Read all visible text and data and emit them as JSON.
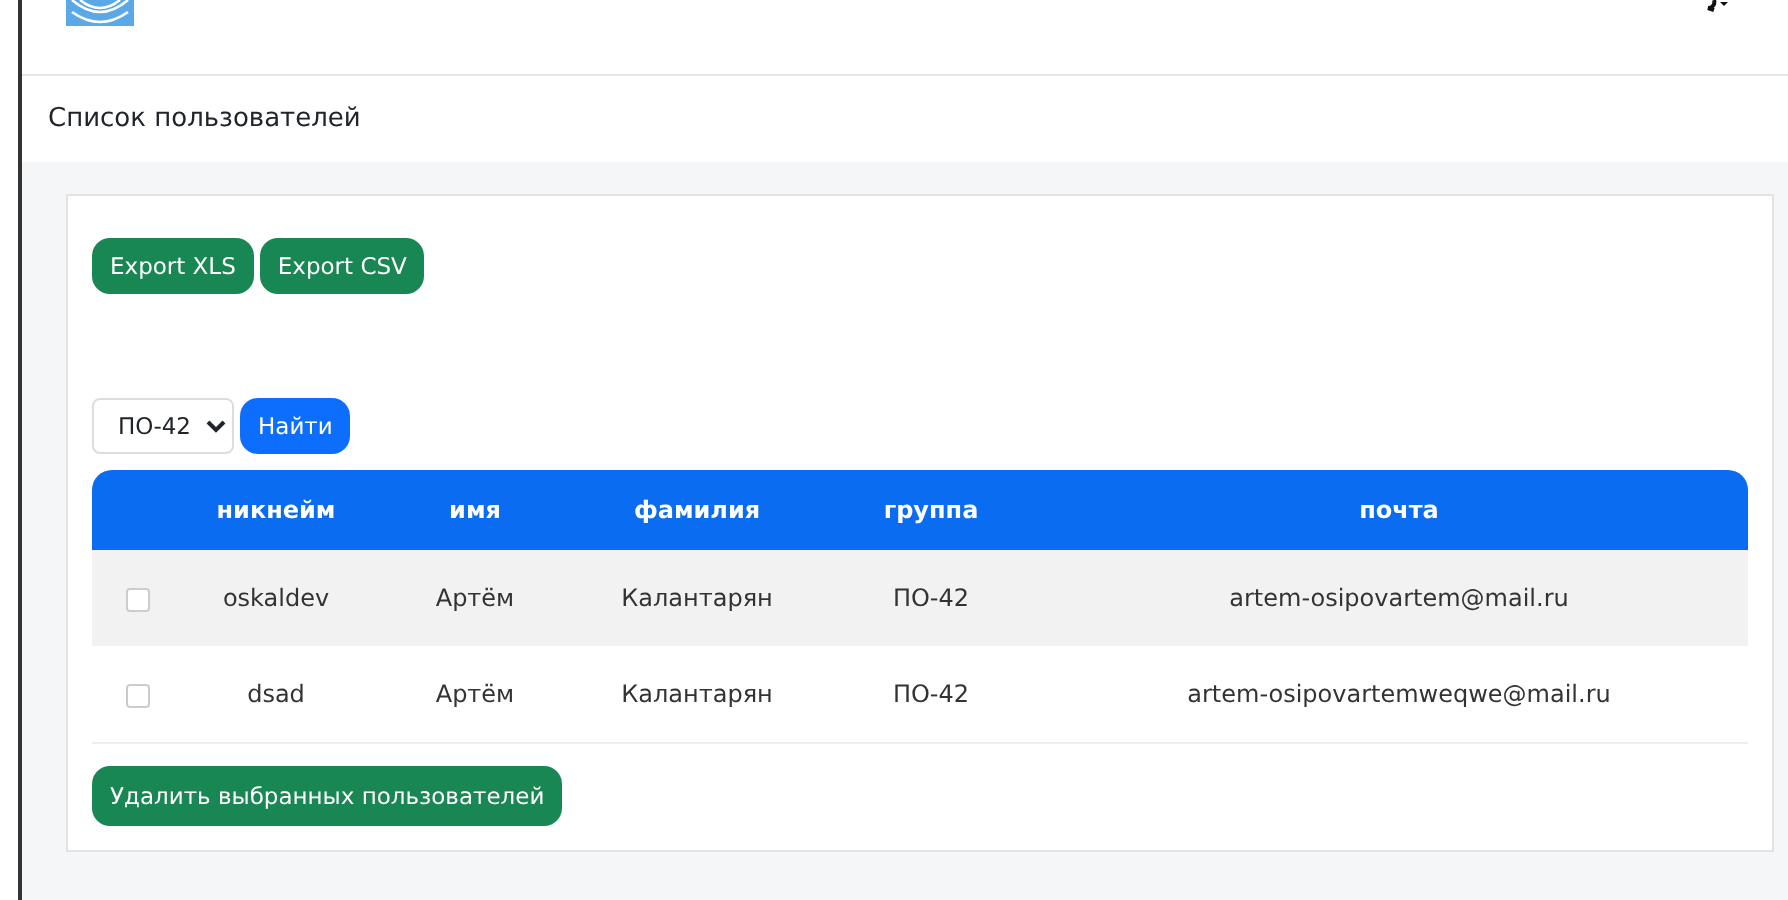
{
  "page_title": "Список пользователей",
  "export_buttons": [
    "Export XLS",
    "Export CSV"
  ],
  "filter": {
    "group_value": "ПО-42",
    "search_button": "Найти"
  },
  "table": {
    "columns": [
      "никнейм",
      "имя",
      "фамилия",
      "группа",
      "почта"
    ],
    "rows": [
      {
        "checked": false,
        "cells": [
          "oskaldev",
          "Артём",
          "Калантарян",
          "ПО-42",
          "artem-osipovartem@mail.ru"
        ]
      },
      {
        "checked": false,
        "cells": [
          "dsad",
          "Артём",
          "Калантарян",
          "ПО-42",
          "artem-osipovartemweqwe@mail.ru"
        ]
      }
    ]
  },
  "delete_button": "Удалить выбранных пользователей"
}
